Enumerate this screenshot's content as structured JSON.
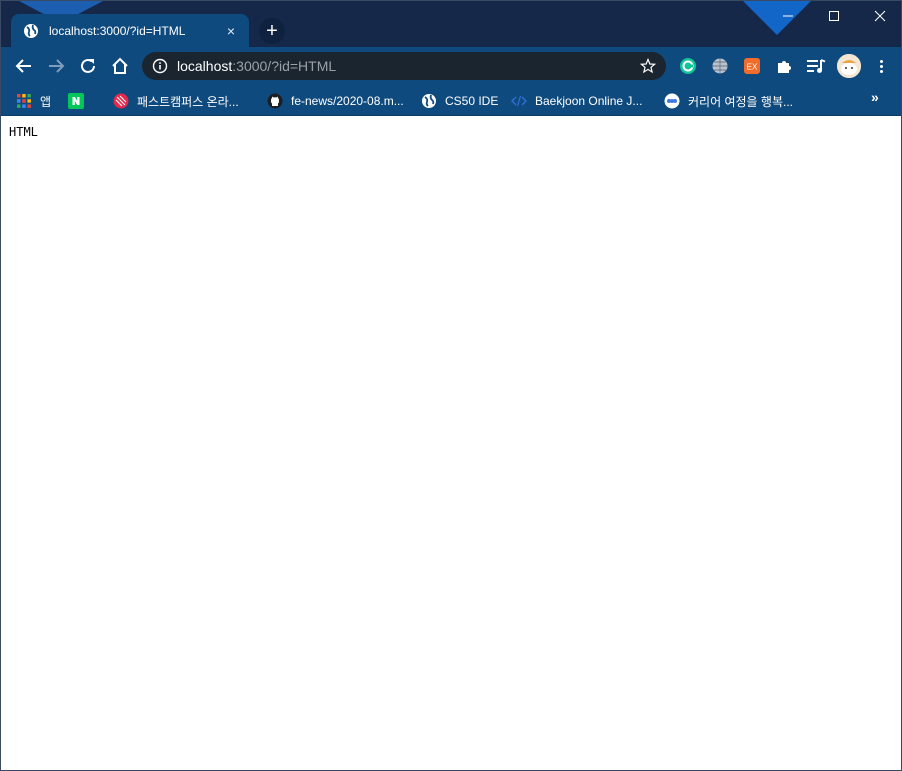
{
  "browser": {
    "tab": {
      "title": "localhost:3000/?id=HTML",
      "favicon": "globe-icon",
      "close": "×"
    },
    "newtab": "+",
    "omnibox": {
      "host": "localhost",
      "rest": ":3000/?id=HTML"
    },
    "bookmarks": [
      {
        "label": "앱",
        "icon": "apps-grid-icon"
      },
      {
        "label": "",
        "icon": "naver-icon"
      },
      {
        "label": "패스트캠퍼스 온라...",
        "icon": "fastcampus-icon"
      },
      {
        "label": "fe-news/2020-08.m...",
        "icon": "github-icon"
      },
      {
        "label": "CS50 IDE",
        "icon": "globe-icon"
      },
      {
        "label": "Baekjoon Online J...",
        "icon": "code-icon"
      },
      {
        "label": "커리어 여정을 행복...",
        "icon": "career-icon"
      }
    ],
    "bookmarks_more": "»",
    "colors": {
      "tabstrip": "#16284a",
      "toolbar": "#0f4a7e",
      "omnibox": "#1a2530"
    }
  },
  "page": {
    "text": "HTML"
  }
}
